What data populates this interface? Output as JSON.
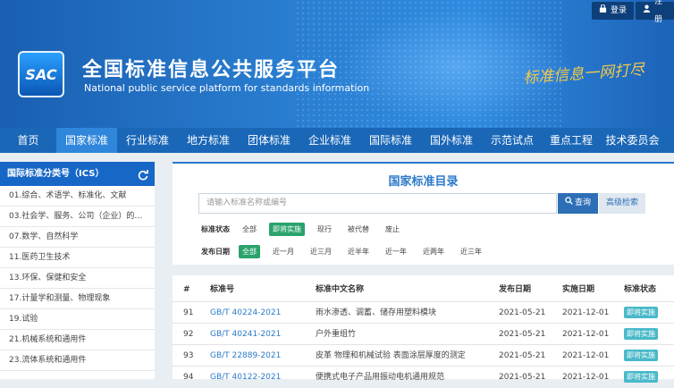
{
  "auth": {
    "login": "登录",
    "register": "注册"
  },
  "header": {
    "logo_text": "SAC",
    "title": "全国标准信息公共服务平台",
    "subtitle": "National public service platform  for standards information",
    "slogan": "标准信息一网打尽"
  },
  "nav": {
    "items": [
      "首页",
      "国家标准",
      "行业标准",
      "地方标准",
      "团体标准",
      "企业标准",
      "国际标准",
      "国外标准",
      "示范试点",
      "重点工程",
      "技术委员会"
    ]
  },
  "sidebar": {
    "title": "国际标准分类号（ICS）",
    "items": [
      "01.综合、术语学、标准化、文献",
      "03.社会学、服务、公司（企业）的组...",
      "07.数学、自然科学",
      "11.医药卫生技术",
      "13.环保、保健和安全",
      "17.计量学和测量、物理现象",
      "19.试验",
      "21.机械系统和通用件",
      "23.流体系统和通用件"
    ]
  },
  "panel": {
    "title": "国家标准目录",
    "search_placeholder": "请输入标准名称或编号",
    "search_button": "查询",
    "advanced_button": "高级检索",
    "status_label": "标准状态",
    "status_options": [
      "全部",
      "即将实施",
      "现行",
      "被代替",
      "废止"
    ],
    "status_selected": "即将实施",
    "date_label": "发布日期",
    "date_options": [
      "全部",
      "近一月",
      "近三月",
      "近半年",
      "近一年",
      "近两年",
      "近三年"
    ],
    "date_selected": "全部"
  },
  "table": {
    "headers": [
      "#",
      "标准号",
      "标准中文名称",
      "发布日期",
      "实施日期",
      "标准状态"
    ],
    "rows": [
      {
        "no": "91",
        "code": "GB/T 40224-2021",
        "name": "雨水渗透、调蓄、储存用塑料模块",
        "pub": "2021-05-21",
        "imp": "2021-12-01",
        "status": "即将实施"
      },
      {
        "no": "92",
        "code": "GB/T 40241-2021",
        "name": "户外重组竹",
        "pub": "2021-05-21",
        "imp": "2021-12-01",
        "status": "即将实施"
      },
      {
        "no": "93",
        "code": "GB/T 22889-2021",
        "name": "皮革 物理和机械试验 表面涂层厚度的测定",
        "pub": "2021-05-21",
        "imp": "2021-12-01",
        "status": "即将实施"
      },
      {
        "no": "94",
        "code": "GB/T 40122-2021",
        "name": "便携式电子产品用振动电机通用规范",
        "pub": "2021-05-21",
        "imp": "2021-12-01",
        "status": "即将实施"
      }
    ]
  },
  "colors": {
    "nav_bg": "#1a67b8",
    "nav_active": "#2f86db",
    "accent": "#2c79c9",
    "badge": "#49b9c9",
    "selected": "#2aa36b"
  }
}
